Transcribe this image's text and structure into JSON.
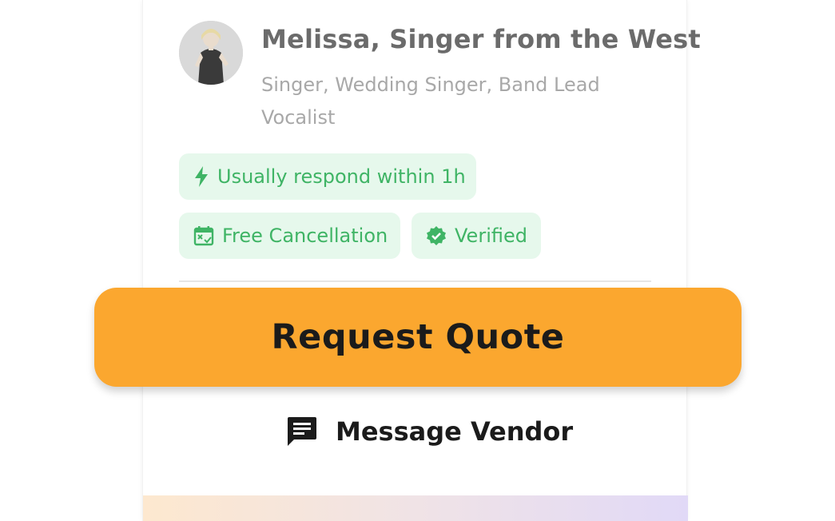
{
  "vendor": {
    "name": "Melissa, Singer from the West",
    "categories": "Singer, Wedding Singer, Band Lead Vocalist",
    "avatar_alt": "Melissa"
  },
  "badges": {
    "respond": {
      "label": "Usually respond within 1h",
      "icon": "lightning-bolt-icon"
    },
    "cancellation": {
      "label": "Free Cancellation",
      "icon": "calendar-cancel-icon"
    },
    "verified": {
      "label": "Verified",
      "icon": "verified-badge-icon"
    }
  },
  "actions": {
    "request_quote": "Request Quote",
    "message_vendor": "Message Vendor",
    "message_icon": "chat-message-icon"
  },
  "colors": {
    "accent": "#fba72f",
    "badge_bg": "#e6f8ec",
    "badge_text": "#3fb465",
    "name_text": "#6b6b6b",
    "category_text": "#a8a8a8"
  }
}
